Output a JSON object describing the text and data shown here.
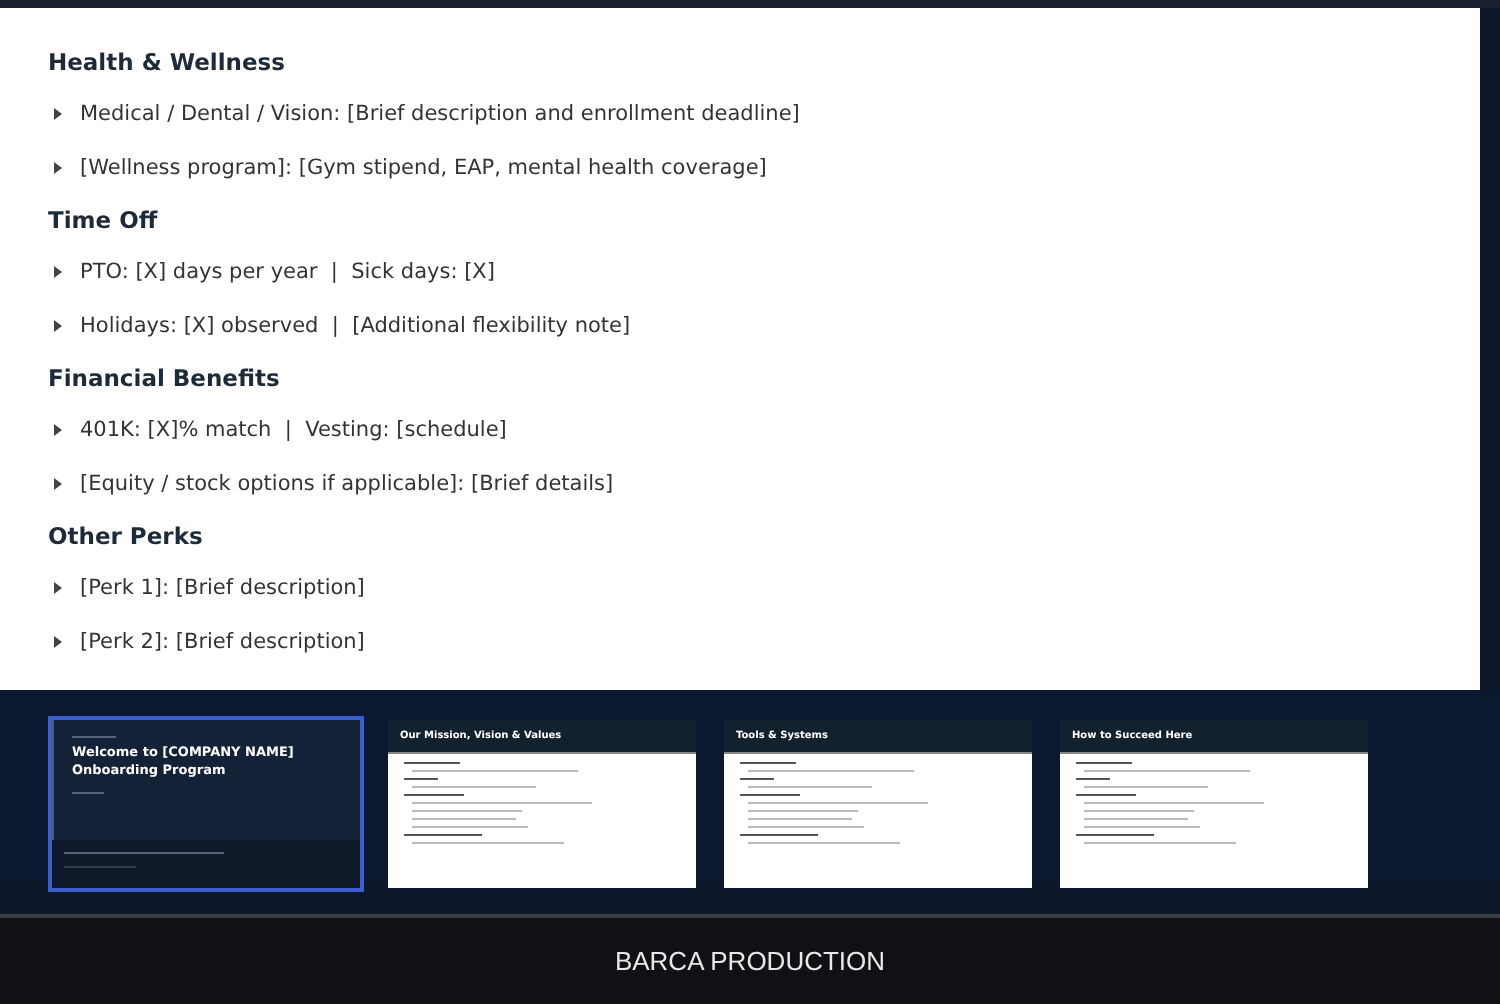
{
  "slide": {
    "sections": [
      {
        "heading": "Health & Wellness",
        "items": [
          "Medical / Dental / Vision: [Brief description and enrollment deadline]",
          "[Wellness program]: [Gym stipend, EAP, mental health coverage]"
        ]
      },
      {
        "heading": "Time Off",
        "items": [
          "PTO: [X] days per year  |  Sick days: [X]",
          "Holidays: [X] observed  |  [Additional flexibility note]"
        ]
      },
      {
        "heading": "Financial Benefits",
        "items": [
          "401K: [X]% match  |  Vesting: [schedule]",
          "[Equity / stock options if applicable]: [Brief details]"
        ]
      },
      {
        "heading": "Other Perks",
        "items": [
          "[Perk 1]: [Brief description]",
          "[Perk 2]: [Brief description]"
        ]
      }
    ]
  },
  "thumbnails": [
    {
      "kind": "title",
      "title": "Welcome to [COMPANY NAME] Onboarding Program",
      "selected": true
    },
    {
      "kind": "content",
      "title": "Our Mission, Vision & Values",
      "selected": false
    },
    {
      "kind": "content",
      "title": "Tools & Systems",
      "selected": false
    },
    {
      "kind": "content",
      "title": "How to Succeed Here",
      "selected": false
    }
  ],
  "footer": {
    "label": "BARCA PRODUCTION"
  }
}
